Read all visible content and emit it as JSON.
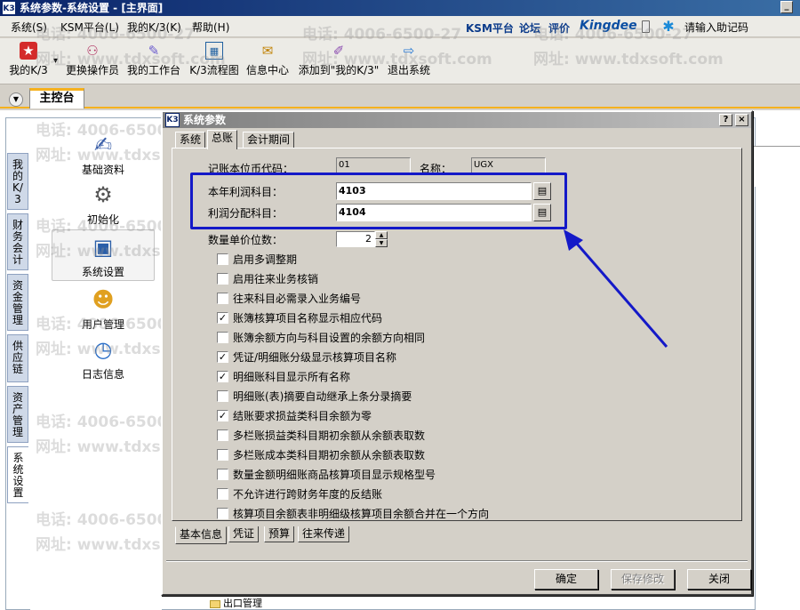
{
  "window": {
    "title": "系统参数-系统设置 - [主界面]",
    "app_icon_text": "K3",
    "minimize_label": "_"
  },
  "menubar": {
    "items": [
      "系统(S)",
      "KSM平台(L)",
      "我的K/3(K)",
      "帮助(H)"
    ],
    "brand_links": [
      "KSM平台",
      "论坛",
      "评价"
    ],
    "brand_logo": "Kingdee",
    "helper_label": "请输入助记码"
  },
  "toolbar": {
    "items": [
      {
        "label": "我的K/3",
        "icon": "star-icon"
      },
      {
        "label": "更换操作员",
        "icon": "users-icon"
      },
      {
        "label": "我的工作台",
        "icon": "desk-icon"
      },
      {
        "label": "K/3流程图",
        "icon": "flowchart-icon"
      },
      {
        "label": "信息中心",
        "icon": "message-icon"
      },
      {
        "label": "添加到\"我的K/3\"",
        "icon": "add-favorite-icon"
      },
      {
        "label": "退出系统",
        "icon": "exit-icon"
      }
    ],
    "dropdown_arrow": "▾"
  },
  "main_tab": {
    "label": "主控台"
  },
  "vertical_tabs": [
    "我的K/3",
    "财务会计",
    "资金管理",
    "供应链",
    "资产管理",
    "系统设置"
  ],
  "nav_items": [
    {
      "label": "基础资料",
      "icon": "document-edit-icon"
    },
    {
      "label": "初始化",
      "icon": "gear-icon"
    },
    {
      "label": "系统设置",
      "icon": "monitor-settings-icon"
    },
    {
      "label": "用户管理",
      "icon": "user-icon"
    },
    {
      "label": "日志信息",
      "icon": "clock-log-icon"
    }
  ],
  "watermark": {
    "phone": "电话: 4006-6500-27",
    "site": "网址: www.tdxsoft.com"
  },
  "tree_folder_label": "出口管理",
  "dialog": {
    "title": "系统参数",
    "title_icon_text": "K3",
    "help_label": "?",
    "close_label": "×",
    "top_tabs": [
      "系统",
      "总账",
      "会计期间"
    ],
    "active_top_tab": 1,
    "fields": {
      "currency_code_label": "记账本位币代码：",
      "currency_code_value": "01",
      "name_label": "名称：",
      "name_value": "UGX",
      "profit_account_label": "本年利润科目：",
      "profit_account_value": "4103",
      "distribution_account_label": "利润分配科目：",
      "distribution_account_value": "4104",
      "quantity_decimals_label": "数量单价位数：",
      "quantity_decimals_value": "2"
    },
    "browse_icon": "browse-icon",
    "options": [
      {
        "label": "启用多调整期",
        "checked": false
      },
      {
        "label": "启用往来业务核销",
        "checked": false
      },
      {
        "label": "往来科目必需录入业务编号",
        "checked": false
      },
      {
        "label": "账簿核算项目名称显示相应代码",
        "checked": true
      },
      {
        "label": "账簿余额方向与科目设置的余额方向相同",
        "checked": false
      },
      {
        "label": "凭证/明细账分级显示核算项目名称",
        "checked": true
      },
      {
        "label": "明细账科目显示所有名称",
        "checked": true
      },
      {
        "label": "明细账(表)摘要自动继承上条分录摘要",
        "checked": false
      },
      {
        "label": "结账要求损益类科目余额为零",
        "checked": true
      },
      {
        "label": "多栏账损益类科目期初余额从余额表取数",
        "checked": false
      },
      {
        "label": "多栏账成本类科目期初余额从余额表取数",
        "checked": false
      },
      {
        "label": "数量金额明细账商品核算项目显示规格型号",
        "checked": false
      },
      {
        "label": "不允许进行跨财务年度的反结账",
        "checked": false
      },
      {
        "label": "核算项目余额表非明细级核算项目余额合并在一个方向",
        "checked": false
      }
    ],
    "bottom_tabs": [
      "基本信息",
      "凭证",
      "预算",
      "往来传递"
    ],
    "active_bottom_tab": 0,
    "buttons": {
      "ok": "确定",
      "save": "保存修改",
      "close": "关闭"
    }
  },
  "colors": {
    "highlight": "#1419c8",
    "title_bar": "#0a246a",
    "tab_accent": "#f5b11e"
  }
}
